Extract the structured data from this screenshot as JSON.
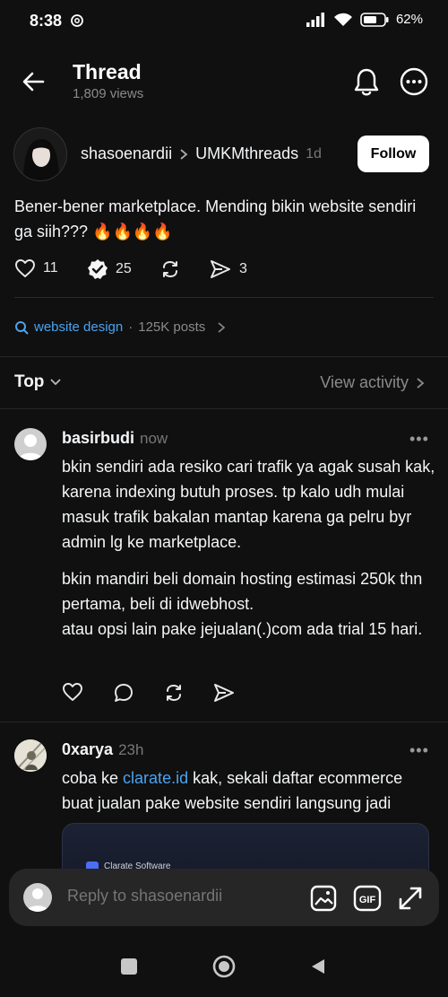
{
  "status_bar": {
    "time": "8:38",
    "battery": "62%"
  },
  "header": {
    "title": "Thread",
    "views": "1,809 views"
  },
  "post": {
    "username": "shasoenardii",
    "community": "UMKMthreads",
    "time_ago": "1d",
    "follow_label": "Follow",
    "text": "Bener-bener marketplace. Mending bikin website sendiri ga siih??? 🔥🔥🔥🔥",
    "likes": "11",
    "reposts": "25",
    "shares": "3"
  },
  "topic": {
    "name": "website design",
    "separator": "·",
    "posts": "125K posts"
  },
  "sort": {
    "label": "Top",
    "view_activity": "View activity"
  },
  "replies": [
    {
      "username": "basirbudi",
      "time_ago": "now",
      "paragraph1": "bkin sendiri ada resiko cari trafik ya agak susah kak, karena indexing butuh proses. tp kalo udh mulai masuk trafik bakalan mantap karena ga pelru byr admin lg ke marketplace.",
      "paragraph2_line1": "bkin mandiri beli domain hosting estimasi 250k thn pertama, beli di idwebhost.",
      "paragraph2_line2": "atau opsi lain pake jejualan(.)com ada trial 15 hari."
    },
    {
      "username": "0xarya",
      "time_ago": "23h",
      "text_before_link": "coba ke ",
      "link": "clarate.id",
      "text_after_link": " kak, sekali daftar ecommerce buat jualan pake website sendiri langsung jadi",
      "embed_title": "Clarate Software"
    }
  ],
  "reply_box": {
    "placeholder": "Reply to shasoenardii"
  },
  "more_dots": "•••",
  "icons": {
    "back": "arrow-left-icon",
    "bell": "bell-icon",
    "more": "more-circle-icon",
    "like": "heart-icon",
    "repost": "verified-check-icon",
    "refresh": "repost-icon",
    "share": "send-icon",
    "search": "search-icon",
    "image": "image-icon",
    "gif": "gif-icon",
    "expand": "expand-icon"
  },
  "colors": {
    "background": "#101010",
    "link": "#4aa3f0",
    "muted": "#8a8a8a"
  }
}
